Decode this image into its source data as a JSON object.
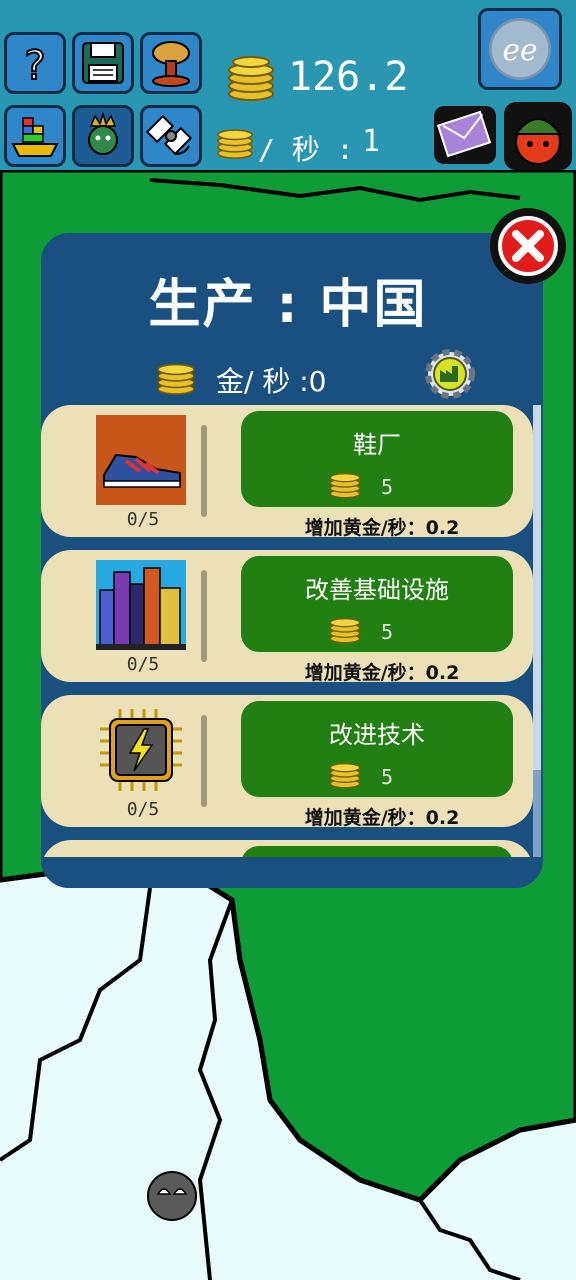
{
  "hud": {
    "gold_amount": "126.2",
    "per_second_label": "/ 秒 :",
    "per_second_value": "1"
  },
  "panel": {
    "title": "生产 : 中国",
    "rate_label": "金/ 秒 :0"
  },
  "production_items": [
    {
      "name": "鞋厂",
      "price": "5",
      "count": "0/5",
      "bonus": "增加黄金/秒：0.2",
      "icon": "sneaker-icon"
    },
    {
      "name": "改善基础设施",
      "price": "5",
      "count": "0/5",
      "bonus": "增加黄金/秒：0.2",
      "icon": "skyscrapers-icon"
    },
    {
      "name": "改进技术",
      "price": "5",
      "count": "0/5",
      "bonus": "增加黄金/秒：0.2",
      "icon": "microchip-icon"
    }
  ],
  "colors": {
    "topbar": "#2a97b2",
    "panel": "#1a5080",
    "card": "#ece0b6",
    "buy_button": "#227f12",
    "map_green": "#0e9c36",
    "map_water": "#e8fbfd"
  }
}
